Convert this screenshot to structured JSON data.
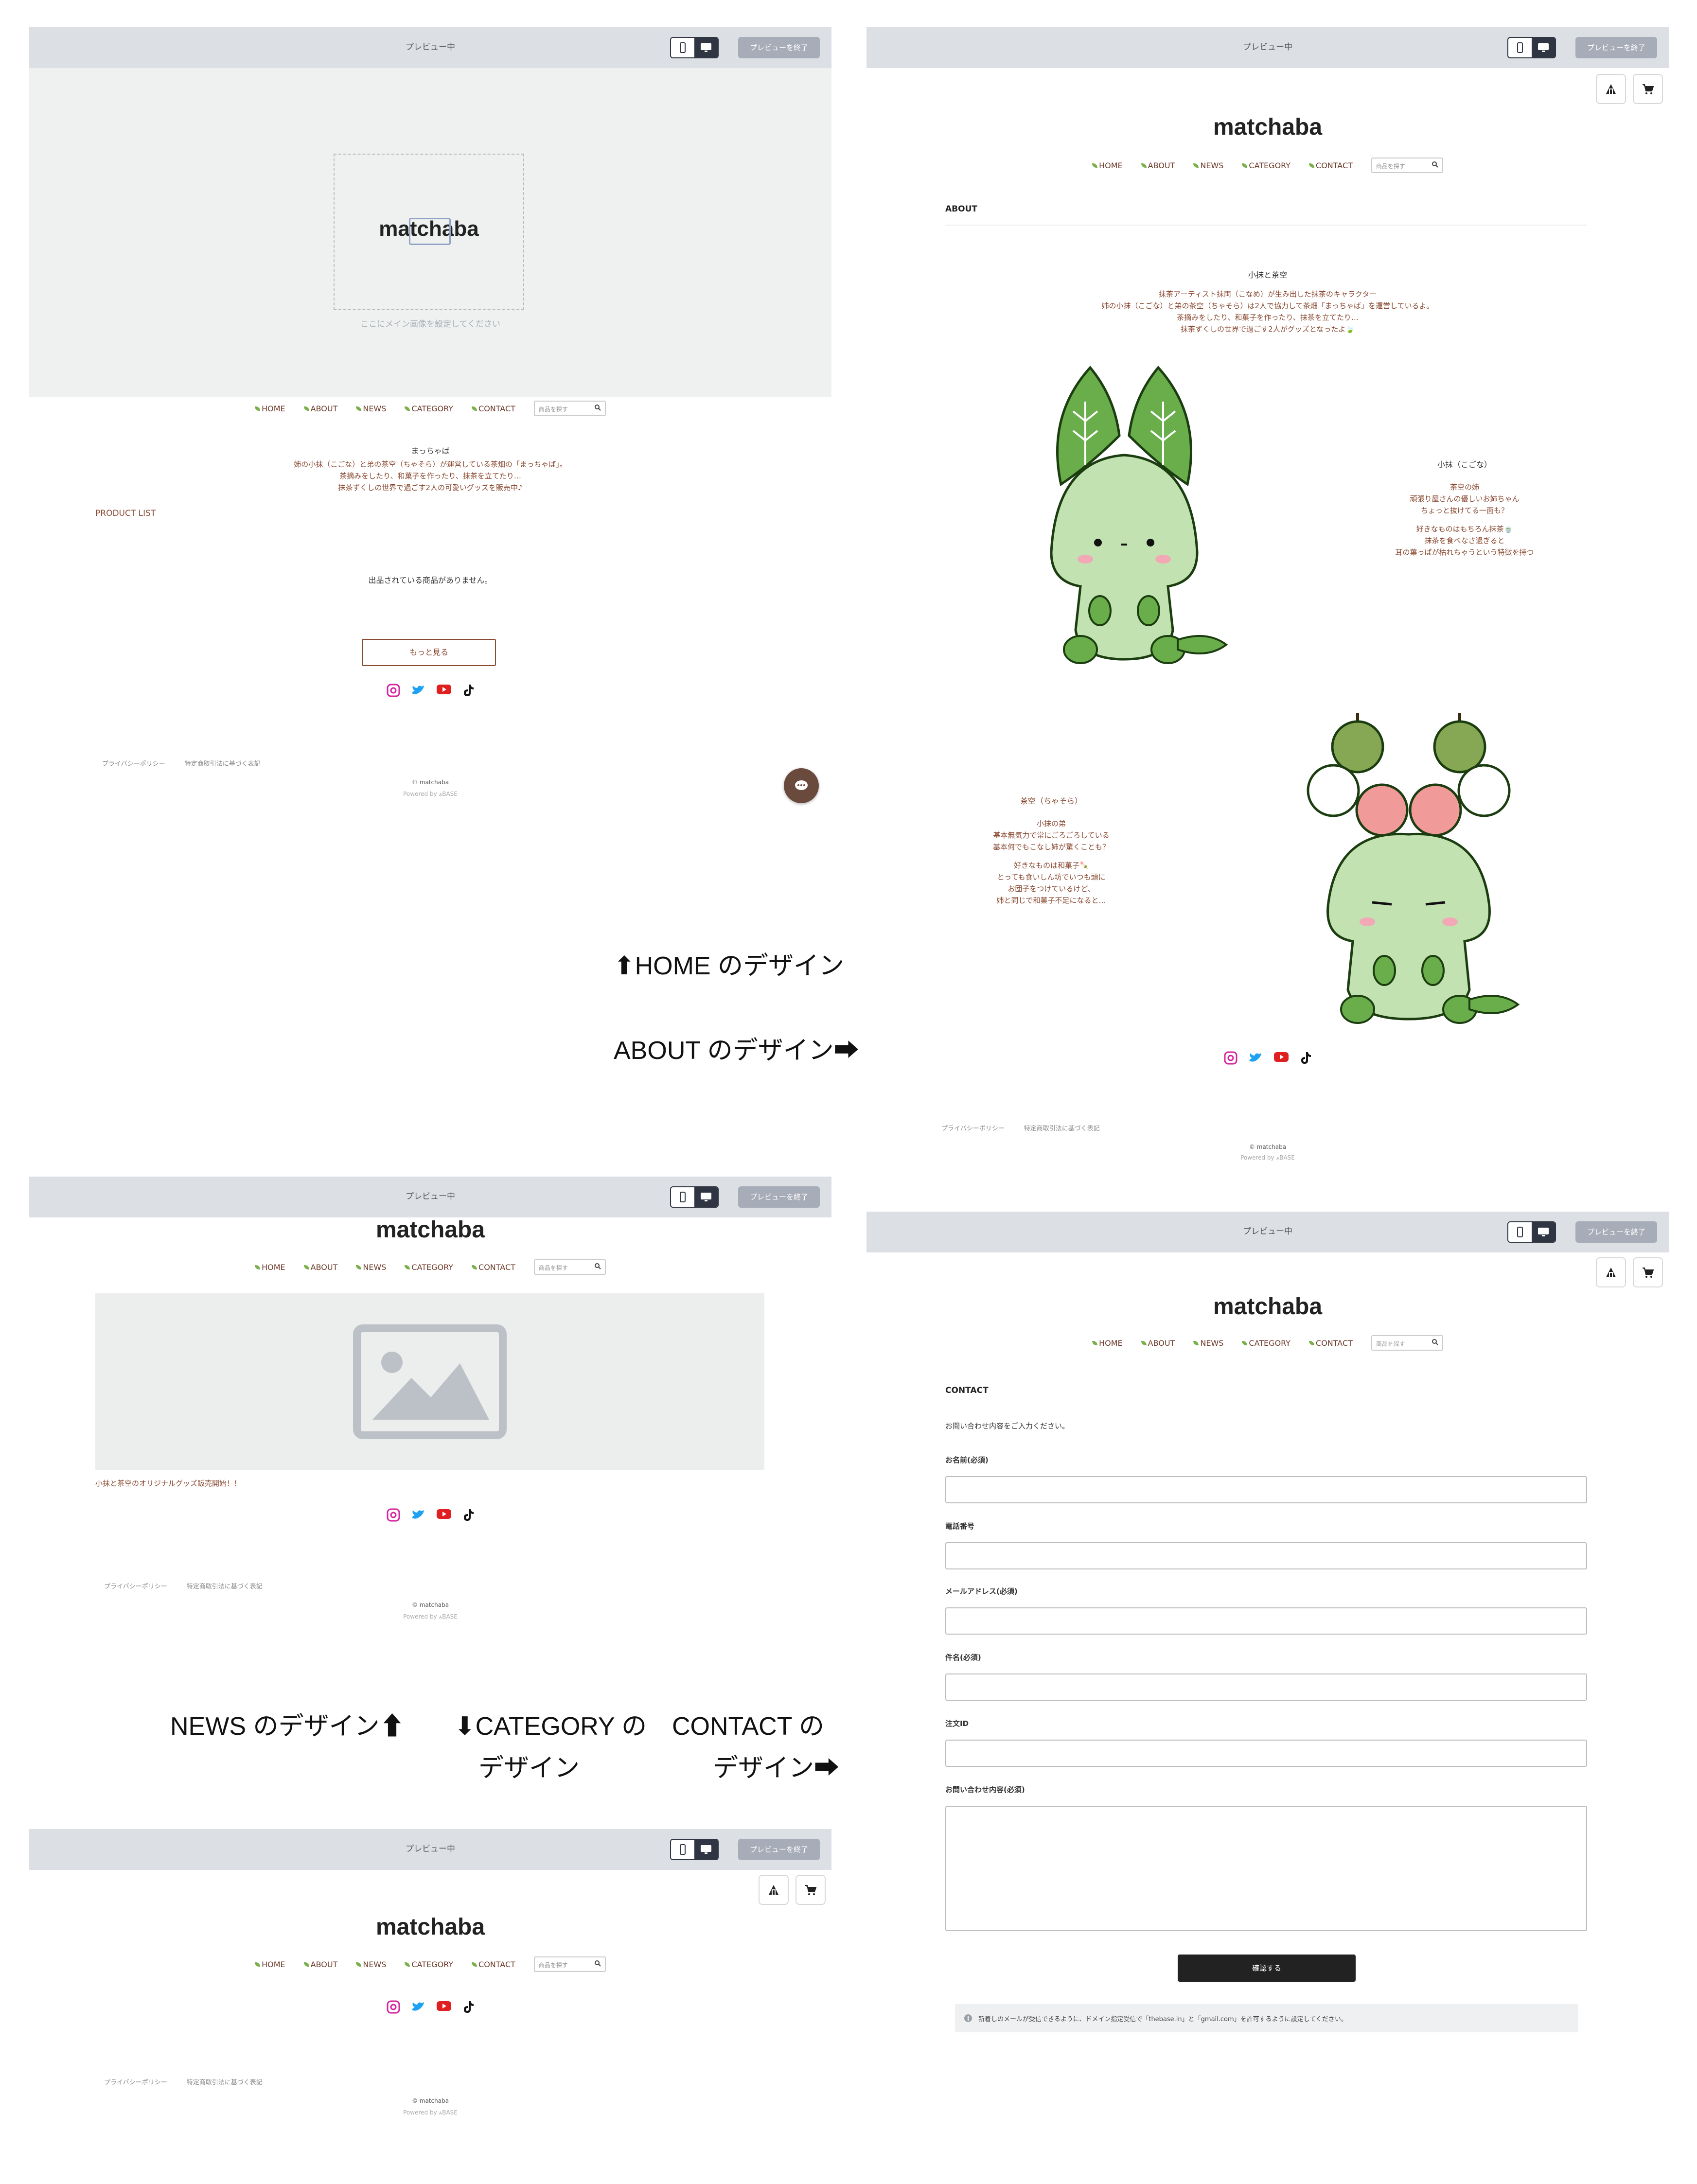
{
  "preview": {
    "title": "プレビュー中",
    "end_label": "プレビューを終了"
  },
  "store": {
    "logo": "matchaba"
  },
  "nav": {
    "home": "HOME",
    "about": "ABOUT",
    "news": "NEWS",
    "category": "CATEGORY",
    "contact": "CONTACT",
    "search_placeholder": "商品を探す"
  },
  "footer": {
    "privacy": "プライバシーポリシー",
    "tokutei": "特定商取引法に基づく表記",
    "copyright": "© matchaba",
    "powered": "Powered by ⩓BASE"
  },
  "home": {
    "placeholder_note": "ここにメイン画像を設定してください",
    "intro_title": "まっちゃば",
    "intro_lines": [
      "姉の小抹（こごな）と弟の茶空（ちゃそら）が運営している茶畑の「まっちゃば」。",
      "茶摘みをしたり、和菓子を作ったり、抹茶を立てたり…",
      "抹茶ずくしの世界で過ごす2人の可愛いグッズを販売中♪"
    ],
    "product_list_title": "PRODUCT LIST",
    "empty_message": "出品されている商品がありません。",
    "more_button": "もっと見る"
  },
  "about": {
    "section_title": "ABOUT",
    "title": "小抹と茶空",
    "lines": [
      "抹茶アーティスト抹両（こなめ）が生み出した抹茶のキャラクター",
      "姉の小抹（こごな）と弟の茶空（ちゃそら）は2人で協力して茶畑「まっちゃば」を運営しているよ。",
      "茶摘みをしたり、和菓子を作ったり、抹茶を立てたり…",
      "抹茶ずくしの世界で過ごす2人がグッズとなったよ🍃"
    ],
    "koma_name": "小抹（こごな）",
    "koma_lines": [
      "茶空の姉",
      "頑張り屋さんの優しいお姉ちゃん",
      "ちょっと抜けてる一面も？",
      "好きなものはもちろん抹茶🍵",
      "抹茶を食べなさ過ぎると",
      "耳の葉っぱが枯れちゃうという特徴を持つ"
    ],
    "chasora_name": "茶空（ちゃそら）",
    "chasora_lines": [
      "小抹の弟",
      "基本無気力で常にごろごろしている",
      "基本何でもこなし姉が驚くことも？",
      "好きなものは和菓子🍡",
      "とっても食いしん坊でいつも頭に",
      "お団子をつけているけど、",
      "姉と同じで和菓子不足になると…"
    ]
  },
  "news": {
    "caption": "小抹と茶空のオリジナルグッズ販売開始！！"
  },
  "contact": {
    "section_title": "CONTACT",
    "intro": "お問い合わせ内容をご入力ください。",
    "fields": [
      "お名前(必須)",
      "電話番号",
      "メールアドレス(必須)",
      "件名(必須)",
      "注文ID",
      "お問い合わせ内容(必須)"
    ],
    "confirm_button": "確認する",
    "notice": "新着しのメールが受信できるように、ドメイン指定受信で「thebase.in」と「gmail.com」を許可するように設定してください。"
  },
  "captions": {
    "home": "⬆HOME のデザイン",
    "about": "ABOUT のデザイン➡",
    "news": "NEWS のデザイン⬆",
    "category_1": "⬇CATEGORY の",
    "category_2": "デザイン",
    "contact_1": "CONTACT の",
    "contact_2": "デザイン➡"
  },
  "colors": {
    "accent_brown": "#8a4a32",
    "leaf_green": "#79b04a",
    "preview_bar": "#dcdfe4",
    "dark_button": "#222222"
  }
}
